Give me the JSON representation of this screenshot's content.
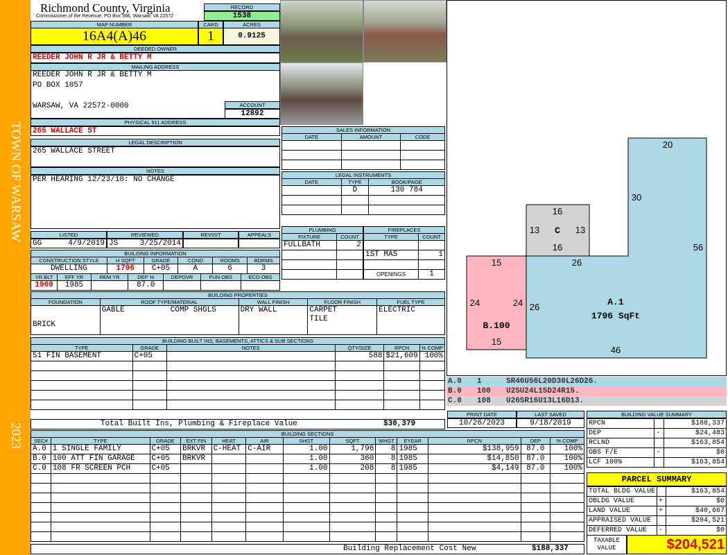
{
  "sidebar": {
    "town": "TOWN OF WARSAW",
    "year": "2023"
  },
  "header": {
    "county": "Richmond County, Virginia",
    "office": "Commissioner of the Revenue, PO Box 366, Warsaw, VA 22572",
    "record_label": "RECORD",
    "record": "1538"
  },
  "parcel": {
    "map_label": "MAP NUMBER",
    "map": "16A4(A)46",
    "card_label": "CARD",
    "card": "1",
    "acres_label": "ACRES",
    "acres": "0.9125"
  },
  "owner": {
    "label": "DEEDED OWNER",
    "name": "REEDER JOHN R JR & BETTY M"
  },
  "mailing": {
    "label": "MAILING ADDRESS",
    "line1": "REEDER JOHN R JR & BETTY M",
    "line2": "PO BOX 1057",
    "line3": "WARSAW, VA 22572-0000",
    "account_label": "ACCOUNT",
    "account": "12892"
  },
  "physical": {
    "label": "PHYSICAL 911 ADDRESS",
    "value": "265 WALLACE ST"
  },
  "legal": {
    "label": "LEGAL DESCRIPTION",
    "value": "265 WALLACE STREET"
  },
  "notes": {
    "label": "NOTES",
    "value": "PER HEARING 12/23/10: NO CHANGE"
  },
  "review": {
    "listed_label": "LISTED",
    "reviewed_label": "REVIEWED",
    "revisit_label": "REVISIT",
    "appeals_label": "APPEALS",
    "listed_by": "GG",
    "listed_date": "4/9/2019",
    "reviewed_by": "JS",
    "reviewed_date": "3/25/2014"
  },
  "building_info": {
    "label": "BUILDING INFORMATION",
    "h1": [
      "CONSTRUCTION STYLE",
      "H SQFT",
      "GRADE",
      "COND",
      "ROOMS",
      "BDRMS"
    ],
    "v1": [
      "DWELLING",
      "1796",
      "C+05",
      "A",
      "6",
      "3"
    ],
    "h2": [
      "YR BLT",
      "EFF YR",
      "REM YR",
      "DEP %",
      "DEPOVR",
      "FUN OBS",
      "ECO OBS"
    ],
    "v2": [
      "1969",
      "1985",
      "",
      "87.0",
      "",
      "",
      ""
    ]
  },
  "sales": {
    "label": "SALES INFORMATION",
    "cols": [
      "DATE",
      "AMOUNT",
      "CODE"
    ]
  },
  "instruments": {
    "label": "LEGAL INSTRUMENTS",
    "cols": [
      "DATE",
      "TYPE",
      "BOOK/PAGE"
    ],
    "row": [
      "",
      "D",
      "130 784"
    ]
  },
  "plumbing": {
    "label": "PLUMBING",
    "cols": [
      "FIXTURE",
      "COUNT"
    ],
    "rows": [
      [
        "FULLBATH",
        "2"
      ]
    ]
  },
  "fireplaces": {
    "label": "FIREPLACES",
    "cols": [
      "TYPE",
      "COUNT"
    ],
    "rows": [
      [
        "1ST MAS",
        "1"
      ]
    ],
    "openings_label": "OPENINGS",
    "openings": "1"
  },
  "properties": {
    "label": "BUILDING PROPERTIES",
    "cols": [
      "FOUNDATION",
      "ROOF TYPE/MATERIAL",
      "WALL FINISH",
      "FLOOR FINISH",
      "FUEL TYPE"
    ],
    "foundation": "BRICK",
    "roof_type": "GABLE",
    "roof_material": "COMP SHGLS",
    "wall": "DRY WALL",
    "floor1": "CARPET",
    "floor2": "TILE",
    "fuel": "ELECTRIC"
  },
  "builtins": {
    "label": "BUILDING BUILT INS, BASEMENTS, ATTICS & SUB SECTIONS",
    "cols": [
      "TYPE",
      "GRADE",
      "NOTES",
      "QTY/SIZE",
      "RPCN",
      "% COMP"
    ],
    "rows": [
      [
        "51 FIN BASEMENT",
        "C+05",
        "",
        "588",
        "$21,609",
        "100%"
      ]
    ],
    "total_label": "Total Built Ins, Plumbing & Fireplace Value",
    "total": "$30,379"
  },
  "dates": {
    "print_label": "PRINT DATE",
    "print": "10/26/2023",
    "saved_label": "LAST SAVED",
    "saved": "9/18/2019"
  },
  "sections": {
    "label": "BUILDING SECTIONS",
    "cols": [
      "SEC#",
      "TYPE",
      "GRADE",
      "EXT FIN",
      "HEAT",
      "AIR",
      "SHGT",
      "SQFT",
      "WHGT",
      "EYEAR",
      "RPCN",
      "DEP",
      "% COMP"
    ],
    "rows": [
      [
        "A.0",
        "1 SINGLE FAMILY",
        "C+05",
        "BRKVR",
        "C-HEAT",
        "C-AIR",
        "1.00",
        "1,796",
        "8",
        "1985",
        "$138,959",
        "87.0",
        "100%"
      ],
      [
        "B.0",
        "100 ATT FIN GARAGE",
        "C+05",
        "BRKVR",
        "",
        "",
        "1.00",
        "360",
        "8",
        "1985",
        "$14,850",
        "87.0",
        "100%"
      ],
      [
        "C.0",
        "108 FR SCREEN PCH",
        "C+05",
        "",
        "",
        "",
        "1.00",
        "208",
        "8",
        "1985",
        "$4,149",
        "87.0",
        "100%"
      ]
    ],
    "total_label": "Building Replacement Cost New",
    "total": "$188,337"
  },
  "sketch": {
    "labels": {
      "a": "A.1",
      "a_area": "1796 SqFt",
      "b": "B.100",
      "c": "C"
    },
    "dims": {
      "a_top": "20",
      "a_upper": "30",
      "a_right": "56",
      "a_step": "26",
      "a_left": "26",
      "a_bottom": "46",
      "c_top": "16",
      "c_left": "13",
      "c_right": "13",
      "c_bottom": "16",
      "b_top": "15",
      "b_left": "24",
      "b_right": "24",
      "b_bottom": "15"
    },
    "segments": [
      [
        "A.0",
        "1",
        "SR46U56L20D30L26D26."
      ],
      [
        "B.0",
        "100",
        "U2SU24L15D24R15."
      ],
      [
        "C.0",
        "108",
        "U26SR16U13L16D13."
      ]
    ],
    "colors": {
      "a": "#ADD8E6",
      "b": "#FFB6C1",
      "c": "#D3D3D3"
    }
  },
  "value_summary": {
    "label": "BUILDING VALUE SUMMARY",
    "rows": [
      [
        "RPCN",
        "",
        "$188,337"
      ],
      [
        "DEP",
        "-",
        "$24,483"
      ],
      [
        "RCLND",
        "",
        "$163,854"
      ],
      [
        "OBS F/E",
        "-",
        "$0"
      ],
      [
        "LCF 100%",
        "",
        "$163,854"
      ]
    ]
  },
  "parcel_summary": {
    "label": "PARCEL SUMMARY",
    "rows": [
      [
        "TOTAL BLDG VALUE",
        "",
        "$163,854"
      ],
      [
        "OBLDG VALUE",
        "+",
        "$0"
      ],
      [
        "LAND VALUE",
        "+",
        "$40,667"
      ],
      [
        "APPRAISED VALUE",
        "",
        "$204,521"
      ],
      [
        "DEFERRED VALUE",
        "-",
        "$0"
      ]
    ],
    "taxable_label": "TAXABLE VALUE",
    "taxable": "$204,521"
  }
}
